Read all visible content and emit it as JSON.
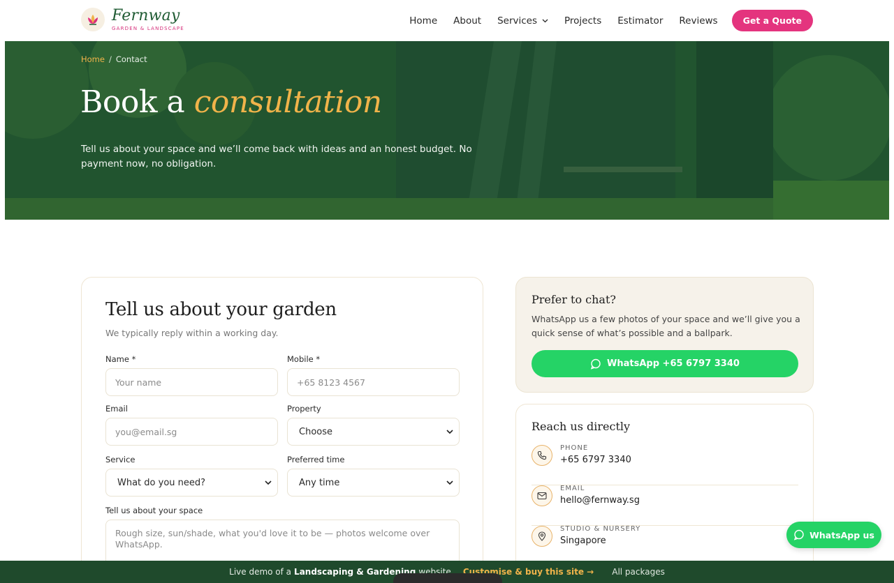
{
  "brand": {
    "name": "Fernway",
    "tagline": "GARDEN & LANDSCAPE",
    "accent": "#e4347e",
    "green": "#1f5b33",
    "gold": "#f0b34a"
  },
  "nav": {
    "items": [
      "Home",
      "About",
      "Services",
      "Projects",
      "Estimator",
      "Reviews"
    ],
    "cta": "Get a Quote"
  },
  "hero": {
    "breadcrumb": {
      "home": "Home",
      "sep": "/",
      "current": "Contact"
    },
    "title_plain": "Book a",
    "title_accent": "consultation",
    "subtitle": "Tell us about your space and we’ll come back with ideas and an honest budget. No payment now, no obligation."
  },
  "form": {
    "title": "Tell us about your garden",
    "subtitle": "We typically reply within a working day.",
    "name_label": "Name *",
    "name_placeholder": "Your name",
    "mobile_label": "Mobile *",
    "mobile_placeholder": "+65 8123 4567",
    "email_label": "Email",
    "email_placeholder": "you@email.sg",
    "property_label": "Property",
    "property_value": "Choose",
    "service_label": "Service",
    "service_value": "What do you need?",
    "time_label": "Preferred time",
    "time_value": "Any time",
    "space_label": "Tell us about your space",
    "space_placeholder": "Rough size, sun/shade, what you'd love it to be — photos welcome over WhatsApp."
  },
  "chat": {
    "title": "Prefer to chat?",
    "text": "WhatsApp us a few photos of your space and we’ll give you a quick sense of what’s possible and a ballpark.",
    "button": "WhatsApp +65 6797 3340"
  },
  "reach": {
    "title": "Reach us directly",
    "rows": [
      {
        "label": "PHONE",
        "value": "+65 6797 3340",
        "icon": "phone-icon"
      },
      {
        "label": "EMAIL",
        "value": "hello@fernway.sg",
        "icon": "mail-icon"
      },
      {
        "label": "STUDIO & NURSERY",
        "value": "Singapore",
        "icon": "map-pin-icon"
      }
    ]
  },
  "float_whatsapp": "WhatsApp us",
  "demo_bar": {
    "prefix": "Live demo of a",
    "bold": "Landscaping & Gardening",
    "suffix": "website",
    "buy": "Customise & buy this site →",
    "packages": "All packages"
  }
}
